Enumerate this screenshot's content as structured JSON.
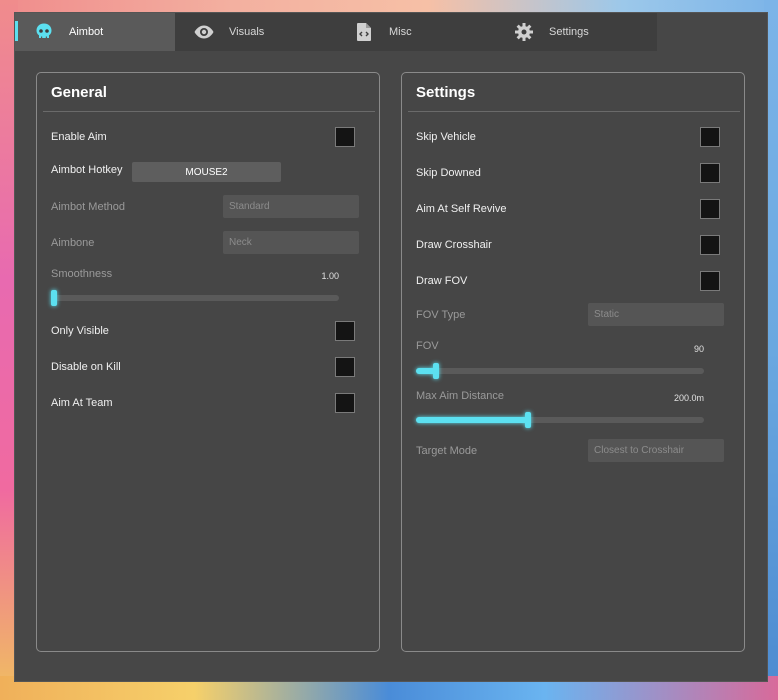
{
  "tabs": [
    {
      "label": "Aimbot",
      "icon": "skull-icon"
    },
    {
      "label": "Visuals",
      "icon": "eye-icon"
    },
    {
      "label": "Misc",
      "icon": "file-code-icon"
    },
    {
      "label": "Settings",
      "icon": "gear-icon"
    }
  ],
  "accent_color": "#5ce0f0",
  "general": {
    "title": "General",
    "enable_aim": {
      "label": "Enable Aim",
      "checked": false
    },
    "aimbot_hotkey": {
      "label": "Aimbot Hotkey",
      "value": "MOUSE2"
    },
    "aimbot_method": {
      "label": "Aimbot Method",
      "value": "Standard"
    },
    "aimbone": {
      "label": "Aimbone",
      "value": "Neck"
    },
    "smoothness": {
      "label": "Smoothness",
      "value": "1.00",
      "fraction": 0.0
    },
    "only_visible": {
      "label": "Only Visible",
      "checked": false
    },
    "disable_on_kill": {
      "label": "Disable on Kill",
      "checked": false
    },
    "aim_at_team": {
      "label": "Aim At Team",
      "checked": false
    }
  },
  "settings": {
    "title": "Settings",
    "skip_vehicle": {
      "label": "Skip Vehicle",
      "checked": false
    },
    "skip_downed": {
      "label": "Skip Downed",
      "checked": false
    },
    "aim_at_self_revive": {
      "label": "Aim At Self Revive",
      "checked": false
    },
    "draw_crosshair": {
      "label": "Draw Crosshair",
      "checked": false
    },
    "draw_fov": {
      "label": "Draw FOV",
      "checked": false
    },
    "fov_type": {
      "label": "FOV Type",
      "value": "Static"
    },
    "fov": {
      "label": "FOV",
      "value": "90",
      "fraction": 0.07
    },
    "max_aim_distance": {
      "label": "Max Aim Distance",
      "value": "200.0m",
      "fraction": 0.39
    },
    "target_mode": {
      "label": "Target Mode",
      "value": "Closest to Crosshair"
    }
  }
}
